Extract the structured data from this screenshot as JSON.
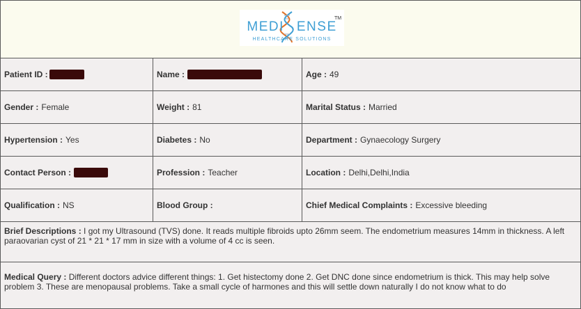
{
  "logo": {
    "brand_prefix": "MEDI",
    "brand_suffix": "ENSE",
    "tagline": "HEALTHCARE SOLUTIONS",
    "tm": "TM",
    "colors": {
      "primary": "#3f9fd4",
      "accent": "#e0732a"
    }
  },
  "fields": {
    "patient_id_label": "Patient ID :",
    "name_label": "Name :",
    "age_label": "Age :",
    "age_value": "49",
    "gender_label": "Gender :",
    "gender_value": "Female",
    "weight_label": "Weight :",
    "weight_value": "81",
    "marital_label": "Marital Status :",
    "marital_value": "Married",
    "hypertension_label": "Hypertension :",
    "hypertension_value": "Yes",
    "diabetes_label": "Diabetes :",
    "diabetes_value": "No",
    "department_label": "Department :",
    "department_value": "Gynaecology Surgery",
    "contact_label": "Contact Person :",
    "profession_label": "Profession :",
    "profession_value": "Teacher",
    "location_label": "Location :",
    "location_value": "Delhi,Delhi,India",
    "qualification_label": "Qualification :",
    "qualification_value": "NS",
    "blood_group_label": "Blood Group :",
    "complaints_label": "Chief Medical Complaints :",
    "complaints_value": "Excessive bleeding"
  },
  "brief": {
    "label": "Brief Descriptions :",
    "text": "I got my Ultrasound (TVS) done. It reads multiple fibroids upto 26mm seem. The endometrium measures 14mm in thickness. A left paraovarian cyst of 21 * 21 * 17 mm in size with a volume of 4 cc is seen."
  },
  "query": {
    "label": "Medical Query :",
    "text": "Different doctors advice different things: 1. Get histectomy done 2. Get DNC done since endometrium is thick. This may help solve problem 3. These are menopausal problems. Take a small cycle of harmones and this will settle down naturally I do not know what to do"
  },
  "colors": {
    "border": "#5a5a5a",
    "header_bg": "#fbfbee",
    "body_bg": "#f2efef",
    "redaction": "#3a0a0a"
  }
}
